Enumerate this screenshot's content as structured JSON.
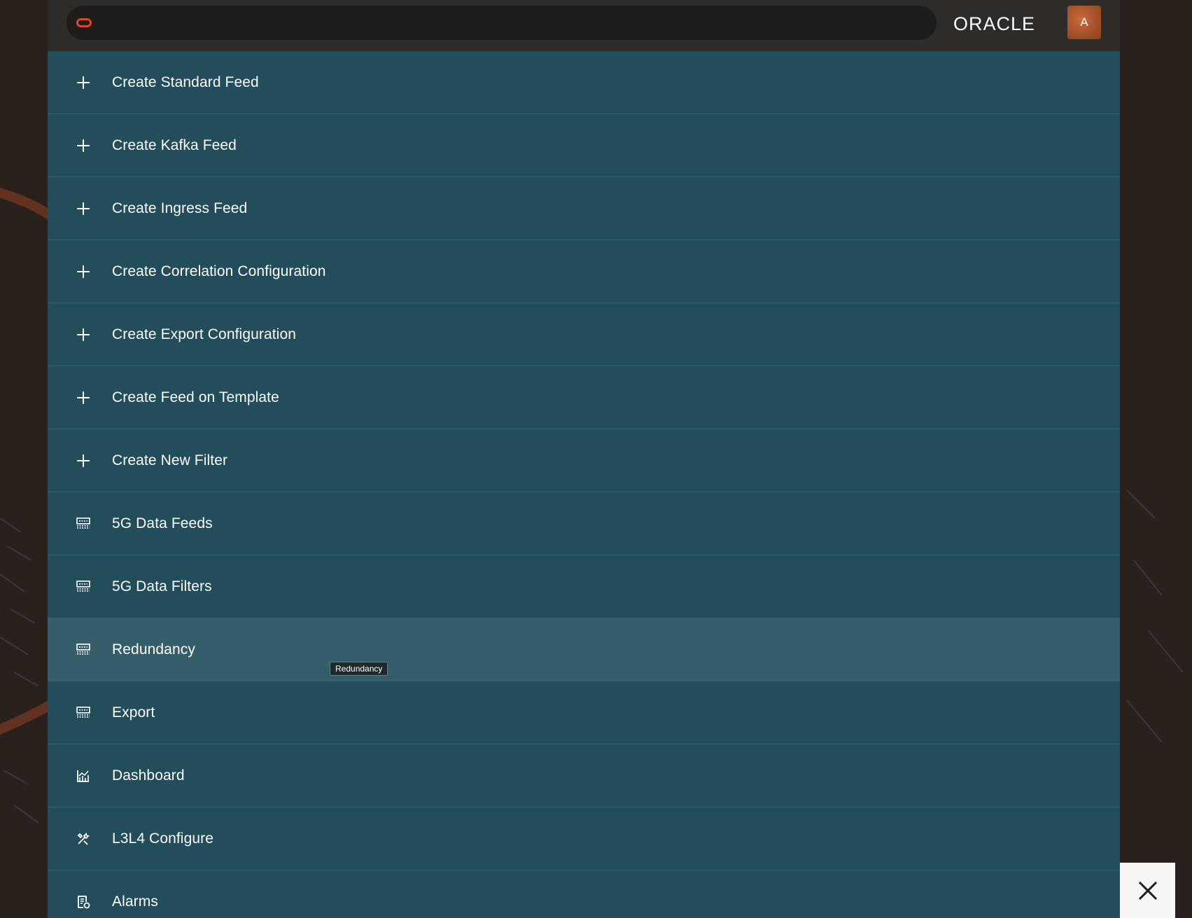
{
  "header": {
    "brand": "ORACLE",
    "avatar_initial": "A",
    "search_icon": "oracle-o-icon"
  },
  "menu": {
    "items": [
      {
        "label": "Create Standard Feed",
        "icon": "plus-icon"
      },
      {
        "label": "Create Kafka Feed",
        "icon": "plus-icon"
      },
      {
        "label": "Create Ingress Feed",
        "icon": "plus-icon"
      },
      {
        "label": "Create Correlation Configuration",
        "icon": "plus-icon"
      },
      {
        "label": "Create Export Configuration",
        "icon": "plus-icon"
      },
      {
        "label": "Create Feed on Template",
        "icon": "plus-icon"
      },
      {
        "label": "Create New Filter",
        "icon": "plus-icon"
      },
      {
        "label": "5G Data Feeds",
        "icon": "table-icon"
      },
      {
        "label": "5G Data Filters",
        "icon": "table-icon"
      },
      {
        "label": "Redundancy",
        "icon": "table-icon"
      },
      {
        "label": "Export",
        "icon": "table-icon"
      },
      {
        "label": "Dashboard",
        "icon": "chart-icon"
      },
      {
        "label": "L3L4 Configure",
        "icon": "tools-icon"
      },
      {
        "label": "Alarms",
        "icon": "alarm-list-icon"
      }
    ]
  },
  "tooltip": {
    "text": "Redundancy"
  },
  "colors": {
    "panel": "#224d5a",
    "active_row": "#335e6a",
    "topbar": "#2f2b28",
    "brand_accent": "#e0442b"
  }
}
